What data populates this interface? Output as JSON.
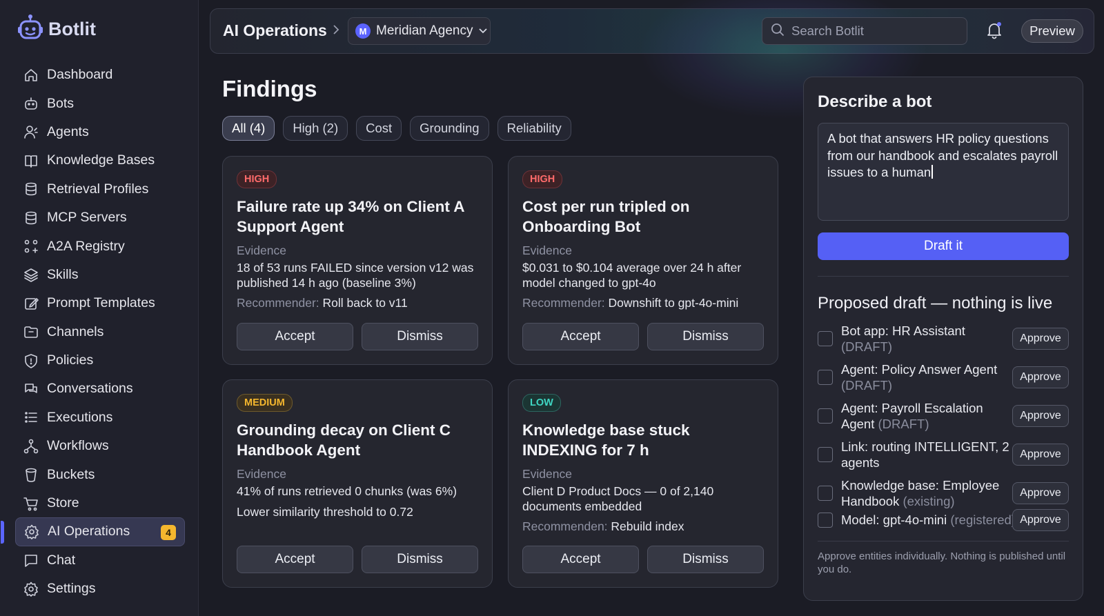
{
  "app": {
    "name": "Botlit"
  },
  "sidebar": {
    "items": [
      {
        "label": "Dashboard",
        "icon": "home-icon"
      },
      {
        "label": "Bots",
        "icon": "bot-icon"
      },
      {
        "label": "Agents",
        "icon": "agent-icon"
      },
      {
        "label": "Knowledge Bases",
        "icon": "book-icon"
      },
      {
        "label": "Retrieval Profiles",
        "icon": "database-icon"
      },
      {
        "label": "MCP Servers",
        "icon": "server-icon"
      },
      {
        "label": "A2A Registry",
        "icon": "network-icon"
      },
      {
        "label": "Skills",
        "icon": "layers-icon"
      },
      {
        "label": "Prompt Templates",
        "icon": "edit-icon"
      },
      {
        "label": "Channels",
        "icon": "folder-icon"
      },
      {
        "label": "Policies",
        "icon": "shield-icon"
      },
      {
        "label": "Conversations",
        "icon": "chat-bubbles-icon"
      },
      {
        "label": "Executions",
        "icon": "list-icon"
      },
      {
        "label": "Workflows",
        "icon": "workflow-icon"
      },
      {
        "label": "Buckets",
        "icon": "bucket-icon"
      },
      {
        "label": "Store",
        "icon": "cart-icon"
      },
      {
        "label": "AI Operations",
        "icon": "gear-icon",
        "active": true,
        "badge": "4"
      },
      {
        "label": "Chat",
        "icon": "chat-icon"
      },
      {
        "label": "Settings",
        "icon": "settings-icon"
      }
    ]
  },
  "header": {
    "title": "AI Operations",
    "agency": {
      "initial": "M",
      "name": "Meridian Agency"
    },
    "search_placeholder": "Search Botlit",
    "preview_label": "Preview"
  },
  "findings": {
    "title": "Findings",
    "filters": [
      "All (4)",
      "High (2)",
      "Cost",
      "Grounding",
      "Reliability"
    ],
    "cards": [
      {
        "severity": "HIGH",
        "title": "Failure rate up 34% on Client A Support Agent",
        "evidence_label": "Evidence",
        "evidence": "18 of 53 runs FAILED since version v12 was published 14 h ago (baseline 3%)",
        "rec_key": "Recommender:",
        "rec_value": "Roll back to v11",
        "accept": "Accept",
        "dismiss": "Dismiss"
      },
      {
        "severity": "HIGH",
        "title": "Cost per run tripled on Onboarding Bot",
        "evidence_label": "Evidence",
        "evidence": "$0.031 to $0.104 average over 24 h after model changed to gpt-4o",
        "rec_key": "Recommender:",
        "rec_value": "Downshift to gpt-4o-mini",
        "accept": "Accept",
        "dismiss": "Dismiss"
      },
      {
        "severity": "MEDIUM",
        "title": "Grounding decay on Client C Handbook Agent",
        "evidence_label": "Evidence",
        "evidence": "41% of runs retrieved 0 chunks (was 6%)",
        "rec_value": "Lower similarity threshold to 0.72",
        "accept": "Accept",
        "dismiss": "Dismiss"
      },
      {
        "severity": "LOW",
        "title": "Knowledge base stuck INDEXING for 7 h",
        "evidence_label": "Evidence",
        "evidence": "Client D Product Docs — 0 of 2,140 documents embedded",
        "rec_key": "Recommenden:",
        "rec_value": "Rebuild index",
        "accept": "Accept",
        "dismiss": "Dismiss"
      }
    ]
  },
  "describe": {
    "title": "Describe a bot",
    "text": "A bot that answers HR policy questions from our handbook and escalates payroll issues to a human",
    "draft_label": "Draft it",
    "proposed_title": "Proposed draft — nothing is live",
    "items": [
      {
        "main": "Bot app: HR Assistant",
        "status": "(DRAFT)",
        "approve": "Approve"
      },
      {
        "main": "Agent: Policy Answer Agent",
        "status": "(DRAFT)",
        "approve": "Approve"
      },
      {
        "main": "Agent: Payroll Escalation Agent",
        "status": "(DRAFT)",
        "approve": "Approve"
      },
      {
        "main": "Link: routing INTELLIGENT, 2 agents",
        "status": "",
        "approve": "Approve"
      },
      {
        "main": "Knowledge base: Employee Handbook",
        "status": "(existing)",
        "approve": "Approve"
      },
      {
        "main": "Model: gpt-4o-mini",
        "status": "(registered)",
        "approve": "Approve"
      }
    ],
    "footnote": "Approve entities individually. Nothing is published until you do."
  },
  "colors": {
    "accent": "#5560f5",
    "high": "#ff6b6b",
    "medium": "#f5b72e",
    "low": "#3fd6c3"
  }
}
